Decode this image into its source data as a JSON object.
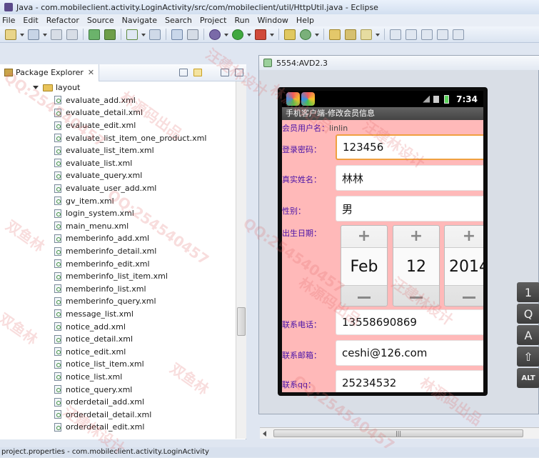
{
  "window": {
    "title": "Java - com.mobileclient.activity.LoginActivity/src/com/mobileclient/util/HttpUtil.java - Eclipse"
  },
  "menubar": {
    "items": [
      "File",
      "Edit",
      "Refactor",
      "Source",
      "Navigate",
      "Search",
      "Project",
      "Run",
      "Window",
      "Help"
    ]
  },
  "package_explorer": {
    "title": "Package Explorer",
    "folder": "layout",
    "files": [
      "evaluate_add.xml",
      "evaluate_detail.xml",
      "evaluate_edit.xml",
      "evaluate_list_item_one_product.xml",
      "evaluate_list_item.xml",
      "evaluate_list.xml",
      "evaluate_query.xml",
      "evaluate_user_add.xml",
      "gv_item.xml",
      "login_system.xml",
      "main_menu.xml",
      "memberinfo_add.xml",
      "memberinfo_detail.xml",
      "memberinfo_edit.xml",
      "memberinfo_list_item.xml",
      "memberinfo_list.xml",
      "memberinfo_query.xml",
      "message_list.xml",
      "notice_add.xml",
      "notice_detail.xml",
      "notice_edit.xml",
      "notice_list_item.xml",
      "notice_list.xml",
      "notice_query.xml",
      "orderdetail_add.xml",
      "orderdetail_detail.xml",
      "orderdetail_edit.xml"
    ]
  },
  "emulator": {
    "title": "5554:AVD2.3",
    "clock": "7:34",
    "app_title": "手机客户端-修改会员信息",
    "form": {
      "username_label": "会员用户名：",
      "username_value": "linlin",
      "password_label": "登录密码：",
      "password_value": "123456",
      "realname_label": "真实姓名：",
      "realname_value": "林林",
      "gender_label": "性别：",
      "gender_value": "男",
      "birthday_label": "出生日期：",
      "date_month": "Feb",
      "date_day": "12",
      "date_year": "2014",
      "phone_label": "联系电话：",
      "phone_value": "13558690869",
      "email_label": "联系邮箱：",
      "email_value": "ceshi@126.com",
      "qq_label": "联系qq：",
      "qq_value": "25234532"
    },
    "keyboard": [
      "1",
      "Q",
      "A",
      "⇧",
      "ALT"
    ]
  },
  "statusbar": {
    "text": "project.properties - com.mobileclient.activity.LoginActivity"
  },
  "watermarks": [
    "QQ:254540457",
    "林源码出品",
    "汪建林设计",
    "双鱼林"
  ]
}
